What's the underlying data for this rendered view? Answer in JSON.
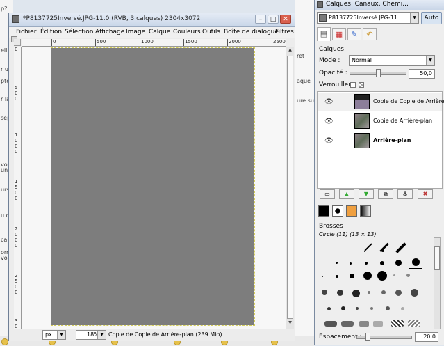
{
  "background": {
    "left_fragments": [
      "p?",
      "ell",
      "r u",
      "pté",
      "r la",
      "sép",
      "vou",
      "une",
      "urs",
      "u ci",
      "cal",
      "orre",
      "voir"
    ],
    "right_fragments": [
      "ret",
      "aque",
      "ure su"
    ]
  },
  "image_window": {
    "title": "*P8137725Inversé.JPG-11.0 (RVB, 3 calques) 2304x3072",
    "controls": {
      "minimize": "–",
      "maximize": "□",
      "close": "✕"
    },
    "menu": [
      "Fichier",
      "Édition",
      "Sélection",
      "Affichage",
      "Image",
      "Calque",
      "Couleurs",
      "Outils",
      "Boîte de dialogue",
      "Filtres"
    ],
    "ruler_ticks": [
      "0",
      "500",
      "1000",
      "1500",
      "2000",
      "2500"
    ],
    "ruler_left_ticks": [
      "0",
      "5",
      "0",
      "0",
      "1",
      "0",
      "0",
      "0",
      "1",
      "5",
      "0",
      "0",
      "2",
      "0",
      "0",
      "0",
      "2",
      "5",
      "0",
      "0",
      "3",
      "0"
    ],
    "status": {
      "unit": "px",
      "zoom": "18%",
      "text": "Copie de Copie de Arrière-plan (239 Mio)"
    }
  },
  "dock": {
    "title": "Calques, Canaux, Chemi...",
    "image_select": "P8137725Inversé.JPG-11",
    "auto_label": "Auto",
    "panel_title": "Calques",
    "mode_label": "Mode :",
    "mode_value": "Normal",
    "opacity_label": "Opacité :",
    "opacity_value": "50,0",
    "opacity_fraction": 0.5,
    "lock_label": "Verrouiller :",
    "layers": [
      {
        "name": "Copie de Copie de Arrière",
        "bold": false,
        "selected": true
      },
      {
        "name": "Copie de Arrière-plan",
        "bold": false,
        "selected": false
      },
      {
        "name": "Arrière-plan",
        "bold": true,
        "selected": false
      }
    ],
    "brushes_title": "Brosses",
    "brush_name": "Circle (11) (13 × 13)",
    "spacing_label": "Espacement :",
    "spacing_value": "20,0",
    "spacing_fraction": 0.2
  },
  "icons": {
    "eye": "eye-icon",
    "dropdown": "chevron-down-icon"
  }
}
